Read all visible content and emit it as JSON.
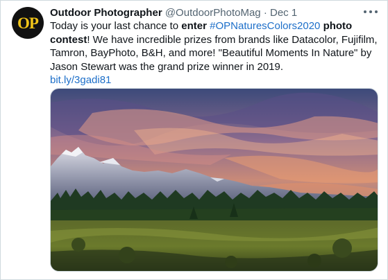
{
  "tweet": {
    "avatar_text": "OP",
    "display_name": "Outdoor Photographer",
    "handle": "@OutdoorPhotoMag",
    "separator": "·",
    "date": "Dec 1",
    "body": {
      "seg1": "Today is your last chance to ",
      "seg2_bold": "enter",
      "seg3": " ",
      "hashtag": "#OPNaturesColors2020",
      "seg4": " ",
      "seg5_bold": "photo contest",
      "seg6": "! We have incredible prizes from brands like Datacolor, Fujifilm, Tamron, BayPhoto, B&H, and more! \"Beautiful Moments In Nature\" by Jason Stewart was the grand prize winner in 2019.",
      "link": "bit.ly/3gadi81"
    }
  },
  "colors": {
    "text": "#0f1419",
    "muted": "#536471",
    "link": "#1d6fc9",
    "avatar_bg": "#111111",
    "avatar_text": "#f0c419"
  },
  "icons": {
    "more": "ellipsis-icon"
  }
}
